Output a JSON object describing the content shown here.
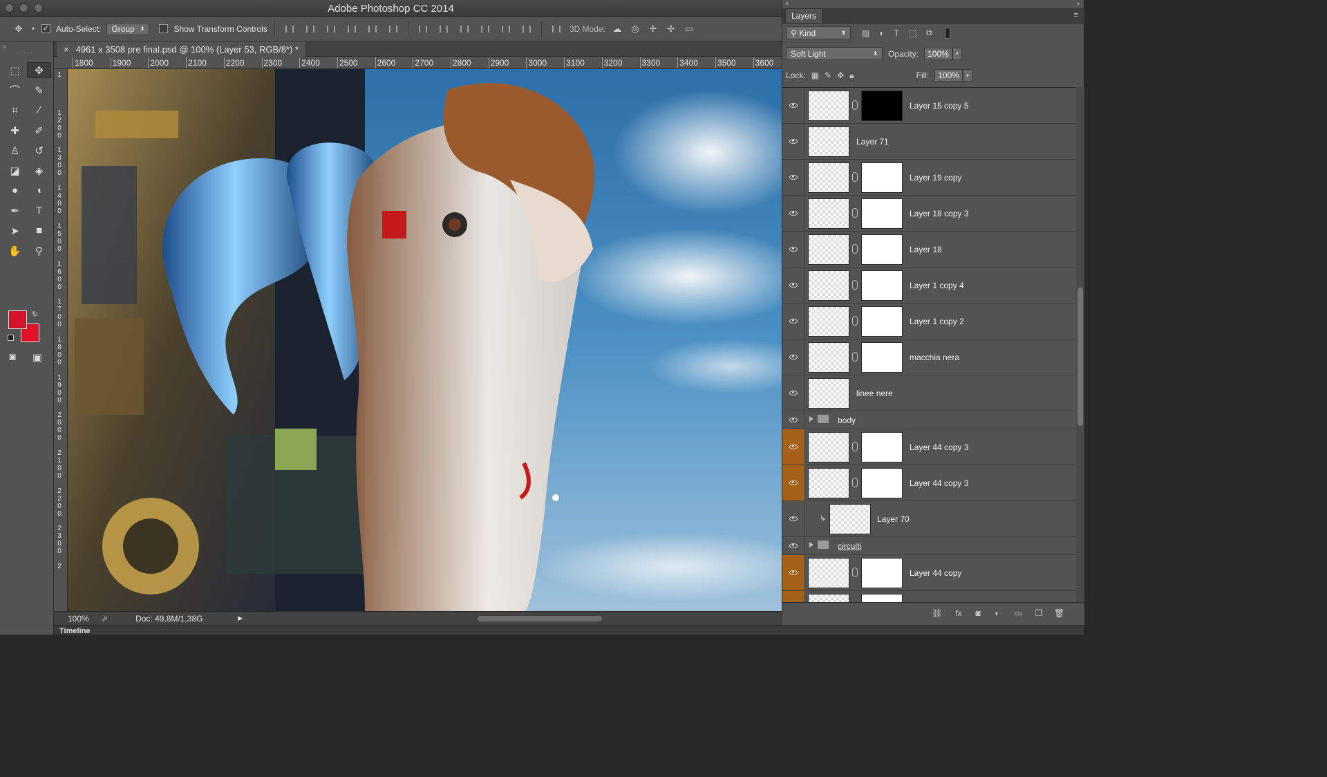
{
  "app": {
    "title": "Adobe Photoshop CC 2014"
  },
  "options_bar": {
    "autoselect_label": "Auto-Select:",
    "autoselect_value": "Group",
    "show_transform_label": "Show Transform Controls",
    "mode3d_label": "3D Mode:"
  },
  "document": {
    "tab_title": "4961 x 3508 pre final.psd @ 100% (Layer 53, RGB/8*) *",
    "close_glyph": "×"
  },
  "ruler": {
    "h_ticks": [
      "1800",
      "1900",
      "2000",
      "2100",
      "2200",
      "2300",
      "2400",
      "2500",
      "2600",
      "2700",
      "2800",
      "2900",
      "3000",
      "3100",
      "3200",
      "3300",
      "3400",
      "3500",
      "3600"
    ],
    "v_labels": [
      [
        "1"
      ],
      [
        "1",
        "2",
        "0",
        "0"
      ],
      [
        "1",
        "3",
        "0",
        "0"
      ],
      [
        "1",
        "4",
        "0",
        "0"
      ],
      [
        "1",
        "5",
        "0",
        "0"
      ],
      [
        "1",
        "6",
        "0",
        "0"
      ],
      [
        "1",
        "7",
        "0",
        "0"
      ],
      [
        "1",
        "8",
        "0",
        "0"
      ],
      [
        "1",
        "9",
        "0",
        "0"
      ],
      [
        "2",
        "0",
        "0",
        "0"
      ],
      [
        "2",
        "1",
        "0",
        "0"
      ],
      [
        "2",
        "2",
        "0",
        "0"
      ],
      [
        "2",
        "3",
        "0",
        "0"
      ],
      [
        "2"
      ]
    ]
  },
  "status": {
    "zoom": "100%",
    "doc": "Doc: 49,8M/1,38G"
  },
  "timeline": {
    "label": "Timeline"
  },
  "colors": {
    "foreground": "#d2132b",
    "background": "#e01026",
    "accent_orange": "#a56117"
  },
  "layers_panel": {
    "tab": "Layers",
    "filter_kind": "Kind",
    "blend_mode": "Soft Light",
    "opacity_label": "Opacity:",
    "opacity_value": "100%",
    "lock_label": "Lock:",
    "fill_label": "Fill:",
    "fill_value": "100%",
    "layers": [
      {
        "name": "Layer 15 copy 5",
        "mask": "black",
        "highlight": false
      },
      {
        "name": "Layer 71",
        "mask": "none",
        "highlight": false
      },
      {
        "name": "Layer 19 copy",
        "mask": "white",
        "highlight": false
      },
      {
        "name": "Layer 18 copy 3",
        "mask": "white",
        "highlight": false
      },
      {
        "name": "Layer 18",
        "mask": "white",
        "highlight": false
      },
      {
        "name": "Layer 1 copy 4",
        "mask": "white",
        "highlight": false
      },
      {
        "name": "Layer 1 copy 2",
        "mask": "white",
        "highlight": false
      },
      {
        "name": "macchia nera",
        "mask": "white",
        "highlight": false
      },
      {
        "name": "linee nere",
        "mask": "none",
        "highlight": false
      },
      {
        "name": "body",
        "type": "group",
        "highlight": false
      },
      {
        "name": "Layer 44 copy 3",
        "mask": "white",
        "highlight": true
      },
      {
        "name": "Layer 44 copy 3",
        "mask": "white",
        "highlight": true
      },
      {
        "name": "Layer 70",
        "mask": "clip",
        "highlight": false
      },
      {
        "name": "circuiti",
        "type": "group",
        "highlight": false
      },
      {
        "name": "Layer 44 copy",
        "mask": "white",
        "highlight": true
      },
      {
        "name": "",
        "mask": "white",
        "highlight": true
      }
    ]
  }
}
